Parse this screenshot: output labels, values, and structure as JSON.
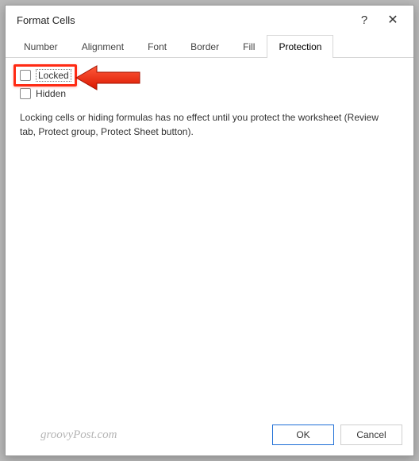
{
  "dialog": {
    "title": "Format Cells",
    "help_symbol": "?",
    "close_symbol": "✕"
  },
  "tabs": {
    "items": [
      {
        "label": "Number"
      },
      {
        "label": "Alignment"
      },
      {
        "label": "Font"
      },
      {
        "label": "Border"
      },
      {
        "label": "Fill"
      },
      {
        "label": "Protection"
      }
    ],
    "active_index": 5
  },
  "protection": {
    "locked_label": "Locked",
    "hidden_label": "Hidden",
    "description": "Locking cells or hiding formulas has no effect until you protect the worksheet (Review tab, Protect group, Protect Sheet button)."
  },
  "footer": {
    "watermark": "groovyPost.com",
    "ok_label": "OK",
    "cancel_label": "Cancel"
  },
  "annotation": {
    "arrow_color": "#ff2a13"
  }
}
